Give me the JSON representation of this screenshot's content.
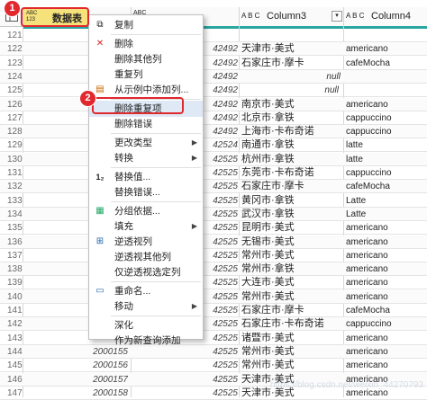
{
  "header": {
    "col1_type": "ABC 123",
    "col1_title": "数据表",
    "col2_type": "ABC",
    "col3_type": "A B C",
    "col3_title": "Column3",
    "col4_type": "A B C",
    "col4_title": "Column4",
    "badge1": "1",
    "badge2": "2"
  },
  "rows": [
    {
      "n": "121",
      "a": "",
      "b": "",
      "c": "",
      "d": ""
    },
    {
      "n": "122",
      "a": "",
      "b": "42492",
      "c": "天津市·美式",
      "d": "americano"
    },
    {
      "n": "123",
      "a": "",
      "b": "42492",
      "c": "石家庄市·摩卡",
      "d": "cafeMocha"
    },
    {
      "n": "124",
      "a": "",
      "b": "42492",
      "c": "null",
      "d": ""
    },
    {
      "n": "125",
      "a": "",
      "b": "42492",
      "c": "",
      "d": "null"
    },
    {
      "n": "126",
      "a": "",
      "b": "42492",
      "c": "南京市·美式",
      "d": "americano"
    },
    {
      "n": "127",
      "a": "",
      "b": "42492",
      "c": "北京市·拿铁",
      "d": "cappuccino"
    },
    {
      "n": "128",
      "a": "",
      "b": "42492",
      "c": "上海市·卡布奇诺",
      "d": "cappuccino"
    },
    {
      "n": "129",
      "a": "",
      "b": "42524",
      "c": "南通市·拿铁",
      "d": "latte"
    },
    {
      "n": "130",
      "a": "",
      "b": "42525",
      "c": "杭州市·拿铁",
      "d": "latte"
    },
    {
      "n": "131",
      "a": "",
      "b": "42525",
      "c": "东莞市·卡布奇诺",
      "d": "cappuccino"
    },
    {
      "n": "132",
      "a": "",
      "b": "42525",
      "c": "石家庄市·摩卡",
      "d": "cafeMocha"
    },
    {
      "n": "133",
      "a": "",
      "b": "42525",
      "c": "黄冈市·拿铁",
      "d": "Latte"
    },
    {
      "n": "134",
      "a": "",
      "b": "42525",
      "c": "武汉市·拿铁",
      "d": "Latte"
    },
    {
      "n": "135",
      "a": "",
      "b": "42525",
      "c": "昆明市·美式",
      "d": "americano"
    },
    {
      "n": "136",
      "a": "",
      "b": "42525",
      "c": "无锡市·美式",
      "d": "americano"
    },
    {
      "n": "137",
      "a": "",
      "b": "42525",
      "c": "常州市·美式",
      "d": "americano"
    },
    {
      "n": "138",
      "a": "",
      "b": "42525",
      "c": "常州市·拿铁",
      "d": "americano"
    },
    {
      "n": "139",
      "a": "",
      "b": "42525",
      "c": "大连市·美式",
      "d": "americano"
    },
    {
      "n": "140",
      "a": "",
      "b": "42525",
      "c": "常州市·美式",
      "d": "americano"
    },
    {
      "n": "141",
      "a": "",
      "b": "42525",
      "c": "石家庄市·摩卡",
      "d": "cafeMocha"
    },
    {
      "n": "142",
      "a": "",
      "b": "42525",
      "c": "石家庄市·卡布奇诺",
      "d": "cappuccino"
    },
    {
      "n": "143",
      "a": "",
      "b": "42525",
      "c": "诸暨市·美式",
      "d": "americano"
    },
    {
      "n": "144",
      "a": "2000155",
      "b": "42525",
      "c": "常州市·美式",
      "d": "americano"
    },
    {
      "n": "145",
      "a": "2000156",
      "b": "42525",
      "c": "常州市·美式",
      "d": "americano"
    },
    {
      "n": "146",
      "a": "2000157",
      "b": "42525",
      "c": "天津市·美式",
      "d": "americano"
    },
    {
      "n": "147",
      "a": "2000158",
      "b": "42525",
      "c": "天津市·美式",
      "d": "americano"
    }
  ],
  "menu": {
    "copy": "复制",
    "remove": "删除",
    "remove_other": "删除其他列",
    "duplicate": "重复列",
    "add_from_example": "从示例中添加列...",
    "remove_duplicates": "删除重复项",
    "remove_errors": "删除错误",
    "change_type": "更改类型",
    "transform": "转换",
    "replace_values": "替换值...",
    "replace_errors": "替换错误...",
    "group_by": "分组依据...",
    "fill": "填充",
    "unpivot": "逆透视列",
    "unpivot_other": "逆透视其他列",
    "unpivot_selected": "仅逆透视选定列",
    "rename": "重命名...",
    "move": "移动",
    "drill_down": "深化",
    "add_as_query": "作为新查询添加"
  },
  "watermark": "https://blog.csdn.net/weixin_44270793",
  "colors": {
    "accent_red": "#e0282e",
    "highlight": "#dfe9f6",
    "teal": "#2aa6a0"
  }
}
